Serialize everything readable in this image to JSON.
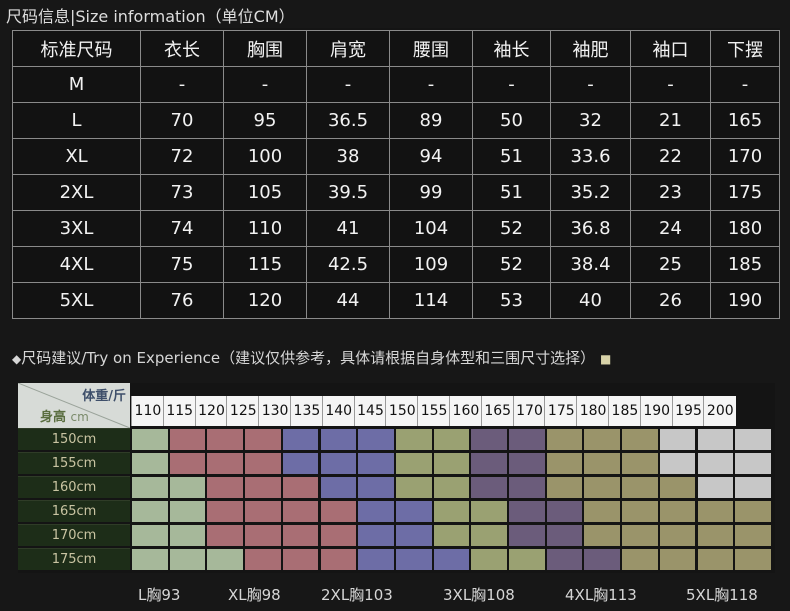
{
  "header_text": "尺码信息|Size information（单位CM）",
  "size_table": {
    "columns": [
      "标准尺码",
      "衣长",
      "胸围",
      "肩宽",
      "腰围",
      "袖长",
      "袖肥",
      "袖口",
      "下摆"
    ],
    "rows": [
      [
        "M",
        "-",
        "-",
        "-",
        "-",
        "-",
        "-",
        "-",
        "-"
      ],
      [
        "L",
        "70",
        "95",
        "36.5",
        "89",
        "50",
        "32",
        "21",
        "165"
      ],
      [
        "XL",
        "72",
        "100",
        "38",
        "94",
        "51",
        "33.6",
        "22",
        "170"
      ],
      [
        "2XL",
        "73",
        "105",
        "39.5",
        "99",
        "51",
        "35.2",
        "23",
        "175"
      ],
      [
        "3XL",
        "74",
        "110",
        "41",
        "104",
        "52",
        "36.8",
        "24",
        "180"
      ],
      [
        "4XL",
        "75",
        "115",
        "42.5",
        "109",
        "52",
        "38.4",
        "25",
        "185"
      ],
      [
        "5XL",
        "76",
        "120",
        "44",
        "114",
        "53",
        "40",
        "26",
        "190"
      ]
    ]
  },
  "hint": {
    "bullet": "◆",
    "text": "尺码建议/Try on Experience（建议仅供参考，具体请根据自身体型和三围尺寸选择）",
    "tail": "■"
  },
  "chart": {
    "weight_label": "体重/斤",
    "height_label": "身高",
    "height_unit": "cm",
    "weights": [
      "110",
      "115",
      "120",
      "125",
      "130",
      "135",
      "140",
      "145",
      "150",
      "155",
      "160",
      "165",
      "170",
      "175",
      "180",
      "185",
      "190",
      "195",
      "200"
    ],
    "heights": [
      "150cm",
      "155cm",
      "160cm",
      "165cm",
      "170cm",
      "175cm"
    ],
    "size_colors": {
      "L": "#a6b89a",
      "XL": "#a96e74",
      "2XL": "#6d6da6",
      "3XL": "#9aa172",
      "4XL": "#6b5c7b",
      "5XL": "#9a946a",
      "X": "#c7c7c7"
    },
    "grid": [
      [
        "L",
        "XL",
        "XL",
        "XL",
        "2XL",
        "2XL",
        "2XL",
        "3XL",
        "3XL",
        "4XL",
        "4XL",
        "5XL",
        "5XL",
        "5XL",
        "X",
        "X",
        "X"
      ],
      [
        "L",
        "XL",
        "XL",
        "XL",
        "2XL",
        "2XL",
        "2XL",
        "3XL",
        "3XL",
        "4XL",
        "4XL",
        "5XL",
        "5XL",
        "5XL",
        "X",
        "X",
        "X"
      ],
      [
        "L",
        "L",
        "XL",
        "XL",
        "XL",
        "2XL",
        "2XL",
        "3XL",
        "3XL",
        "4XL",
        "4XL",
        "5XL",
        "5XL",
        "5XL",
        "5XL",
        "X",
        "X"
      ],
      [
        "L",
        "L",
        "XL",
        "XL",
        "XL",
        "XL",
        "2XL",
        "2XL",
        "3XL",
        "3XL",
        "4XL",
        "4XL",
        "5XL",
        "5XL",
        "5XL",
        "5XL",
        "5XL"
      ],
      [
        "L",
        "L",
        "XL",
        "XL",
        "XL",
        "XL",
        "2XL",
        "2XL",
        "3XL",
        "3XL",
        "4XL",
        "4XL",
        "5XL",
        "5XL",
        "5XL",
        "5XL",
        "5XL"
      ],
      [
        "L",
        "L",
        "L",
        "XL",
        "XL",
        "XL",
        "2XL",
        "2XL",
        "2XL",
        "3XL",
        "3XL",
        "4XL",
        "4XL",
        "5XL",
        "5XL",
        "5XL",
        "5XL"
      ]
    ],
    "scale_labels": [
      "L胸93",
      "XL胸98",
      "2XL胸103",
      "3XL胸108",
      "4XL胸113",
      "5XL胸118"
    ]
  }
}
